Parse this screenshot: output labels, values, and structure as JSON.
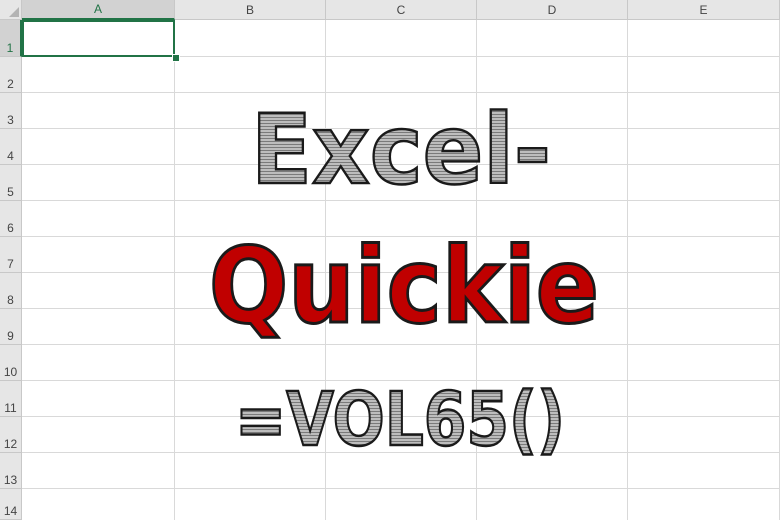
{
  "sheet": {
    "columns": [
      "A",
      "B",
      "C",
      "D",
      "E"
    ],
    "rows": [
      "1",
      "2",
      "3",
      "4",
      "5",
      "6",
      "7",
      "8",
      "9",
      "10",
      "11",
      "12",
      "13",
      "14"
    ],
    "selected_cell": "A1"
  },
  "artwork": {
    "line1": "Excel-",
    "line2": "Quickie",
    "line3": "=VOL65()"
  },
  "colors": {
    "accent_green": "#217346",
    "title_red": "#c00000",
    "title_grey": "#a6a6a6",
    "outline": "#1a1a1a"
  }
}
